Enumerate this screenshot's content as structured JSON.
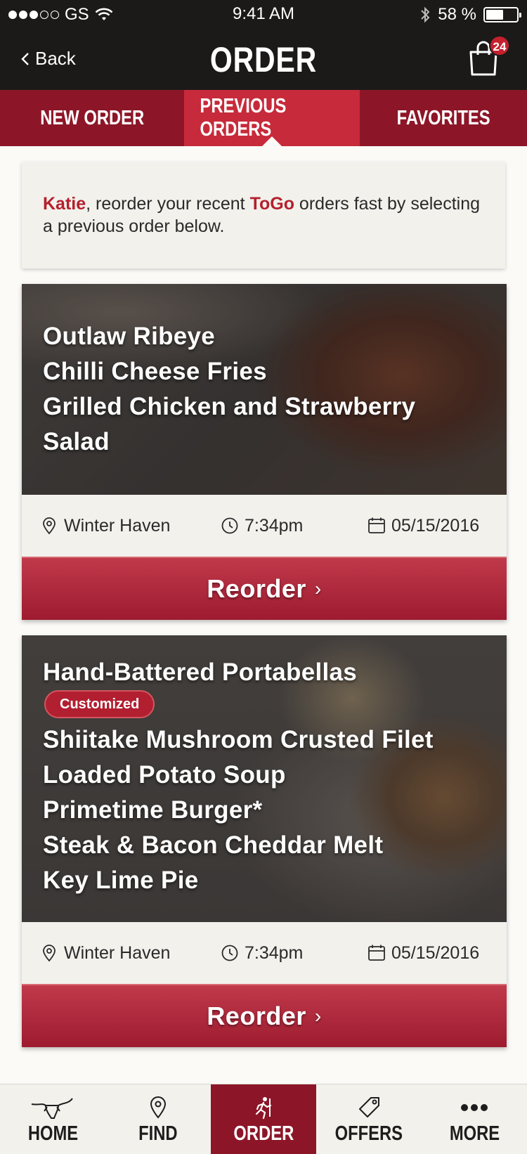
{
  "status_bar": {
    "carrier": "GS",
    "time": "9:41 AM",
    "battery": "58 %",
    "battery_level": 0.58,
    "signal_bars": 3
  },
  "header": {
    "back_label": "Back",
    "title": "ORDER",
    "cart_count": "24"
  },
  "tabs": [
    {
      "label": "NEW ORDER",
      "active": false
    },
    {
      "label": "PREVIOUS ORDERS",
      "active": true
    },
    {
      "label": "FAVORITES",
      "active": false
    }
  ],
  "intro": {
    "name": "Katie",
    "text1": ", reorder your recent ",
    "brand": "ToGo",
    "text2": " orders fast by selecting a previous order below."
  },
  "orders": [
    {
      "items": [
        {
          "name": "Outlaw Ribeye",
          "customized": false
        },
        {
          "name": "Chilli Cheese Fries",
          "customized": false
        },
        {
          "name": "Grilled Chicken and Strawberry Salad",
          "customized": false
        }
      ],
      "location": "Winter Haven",
      "time": "7:34pm",
      "date": "05/15/2016",
      "reorder_label": "Reorder"
    },
    {
      "items": [
        {
          "name": "Hand-Battered Portabellas",
          "customized": true
        },
        {
          "name": "Shiitake Mushroom Crusted Filet",
          "customized": false
        },
        {
          "name": "Loaded Potato Soup",
          "customized": false
        },
        {
          "name": "Primetime Burger*",
          "customized": false
        },
        {
          "name": "Steak & Bacon Cheddar Melt",
          "customized": false
        },
        {
          "name": "Key Lime Pie",
          "customized": false
        }
      ],
      "location": "Winter Haven",
      "time": "7:34pm",
      "date": "05/15/2016",
      "reorder_label": "Reorder"
    }
  ],
  "customized_label": "Customized",
  "bottom_nav": [
    {
      "label": "HOME",
      "icon": "steer-icon",
      "active": false
    },
    {
      "label": "FIND",
      "icon": "location-pin-icon",
      "active": false
    },
    {
      "label": "ORDER",
      "icon": "running-person-icon",
      "active": true
    },
    {
      "label": "OFFERS",
      "icon": "price-tag-icon",
      "active": false
    },
    {
      "label": "MORE",
      "icon": "more-dots-icon",
      "active": false
    }
  ],
  "colors": {
    "brand_red": "#8c1628",
    "accent_red": "#c72a3a",
    "dark": "#1b1a19",
    "cream": "#f2f1ec"
  }
}
